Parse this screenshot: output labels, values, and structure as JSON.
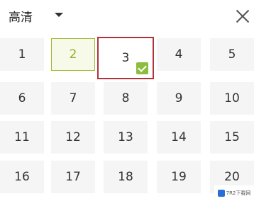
{
  "header": {
    "quality_label": "高清"
  },
  "episodes": [
    "1",
    "2",
    "3",
    "4",
    "5",
    "6",
    "7",
    "8",
    "9",
    "10",
    "11",
    "12",
    "13",
    "14",
    "15",
    "16",
    "17",
    "18",
    "19",
    "20"
  ],
  "watched": [
    "2"
  ],
  "current": "3",
  "colors": {
    "current_border": "#b2323b",
    "watched_border": "#a5b52a",
    "check": "#8cbd3f"
  },
  "watermark": {
    "text": "7R2下载网"
  }
}
